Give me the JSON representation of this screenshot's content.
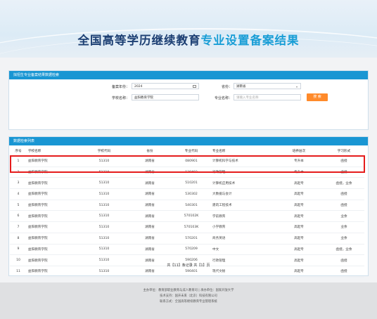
{
  "title": {
    "part1": "全国高等学历继续教育",
    "part2": "专业设置备案结果"
  },
  "filter": {
    "header": "拟招生专业备案结果数据检索",
    "year_label": "备案年份：",
    "year_value": "2024",
    "province_label": "省份：",
    "province_value": "湖南省",
    "school_label": "学校名称：",
    "school_value": "益阳教育学院",
    "major_label": "专业名称：",
    "major_placeholder": "请输入专业名称",
    "search_label": "搜 索"
  },
  "results": {
    "header": "数据检索列表",
    "columns": [
      "序号",
      "学校名称",
      "学校代码",
      "省份",
      "专业代码",
      "专业名称",
      "培养层次",
      "学习形式"
    ],
    "rows": [
      [
        "1",
        "益阳教育学院",
        "51310",
        "湖南省",
        "080901",
        "计算机科学与技术",
        "专升本",
        "函授"
      ],
      [
        "2",
        "益阳教育学院",
        "51310",
        "湖南省",
        "120402",
        "行政管理",
        "专升本",
        "函授"
      ],
      [
        "3",
        "益阳教育学院",
        "51310",
        "湖南省",
        "510201",
        "计算机应用技术",
        "高起专",
        "函授，业余"
      ],
      [
        "4",
        "益阳教育学院",
        "51310",
        "湖南省",
        "530302",
        "大数据与会计",
        "高起专",
        "函授"
      ],
      [
        "5",
        "益阳教育学院",
        "51310",
        "湖南省",
        "540301",
        "建筑工程技术",
        "高起专",
        "函授"
      ],
      [
        "6",
        "益阳教育学院",
        "51310",
        "湖南省",
        "570102K",
        "学前教育",
        "高起专",
        "业余"
      ],
      [
        "7",
        "益阳教育学院",
        "51310",
        "湖南省",
        "570103K",
        "小学教育",
        "高起专",
        "业余"
      ],
      [
        "8",
        "益阳教育学院",
        "51310",
        "湖南省",
        "570201",
        "商务英语",
        "高起专",
        "业余"
      ],
      [
        "9",
        "益阳教育学院",
        "51310",
        "湖南省",
        "570209",
        "中文",
        "高起专",
        "函授，业余"
      ],
      [
        "10",
        "益阳教育学院",
        "51310",
        "湖南省",
        "590206",
        "行政管理",
        "高起专",
        "函授"
      ],
      [
        "11",
        "益阳教育学院",
        "51310",
        "湖南省",
        "590401",
        "现代文秘",
        "高起专",
        "函授"
      ]
    ],
    "pager": "共【11】条记录 共【1】页"
  },
  "footer": {
    "line1": "主办单位：教育部职业教育与成人教育司 | 承办单位：国家开放大学",
    "line2": "技术支持：国开未来（北京）科技有限公司",
    "line3": "联系方式：全国高等继续教育专业管理系统"
  },
  "colors": {
    "title_dark": "#1c3f73",
    "title_accent": "#1a9ed6",
    "panel_header": "#1996d3",
    "search_button": "#ff8a2a",
    "highlight_box": "#e51c1c"
  }
}
